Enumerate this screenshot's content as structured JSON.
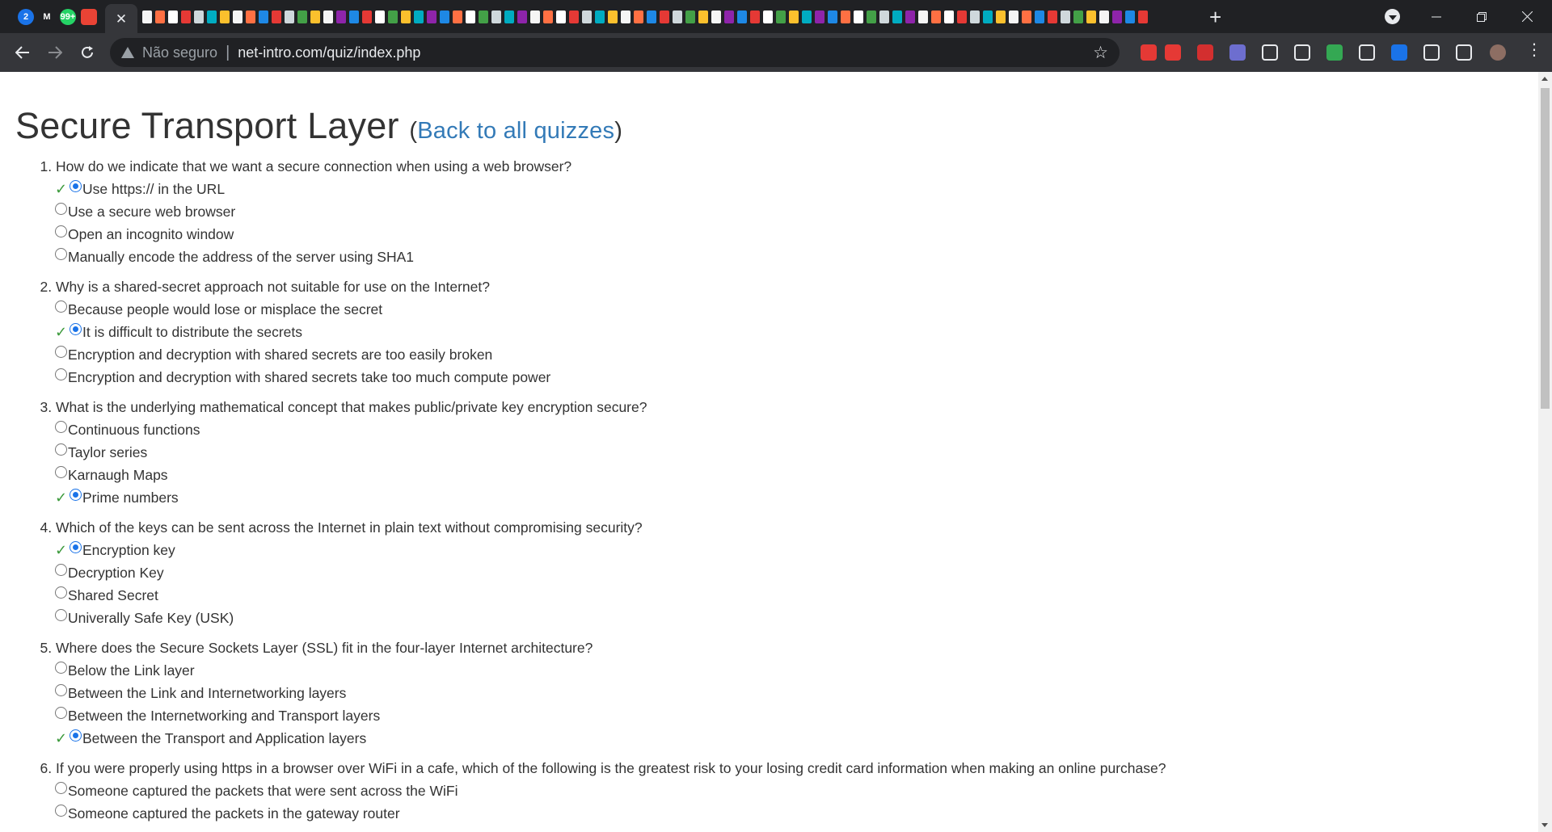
{
  "browser": {
    "pinned_tabs": [
      {
        "icon": "notification-badge-icon",
        "text": "2",
        "color": "#1a73e8"
      },
      {
        "icon": "gmail-icon",
        "text": "M",
        "color": "#202124"
      },
      {
        "icon": "whatsapp-icon",
        "text": "99+",
        "color": "#25d366"
      },
      {
        "icon": "maps-pin-icon",
        "text": "",
        "color": "#ea4335"
      }
    ],
    "active_tab_close": "✕",
    "new_tab": "+",
    "omnibox": {
      "security_status": "Não seguro",
      "separator": "|",
      "url": "net-intro.com/quiz/index.php"
    }
  },
  "page": {
    "title": "Secure Transport Layer",
    "back_open": "(",
    "back_link": "Back to all quizzes",
    "back_close": ")",
    "check_mark": "✓",
    "questions": [
      {
        "text": "How do we indicate that we want a secure connection when using a web browser?",
        "answers": [
          {
            "text": "Use https:// in the URL",
            "selected": true,
            "correct": true
          },
          {
            "text": "Use a secure web browser",
            "selected": false,
            "correct": false
          },
          {
            "text": "Open an incognito window",
            "selected": false,
            "correct": false
          },
          {
            "text": "Manually encode the address of the server using SHA1",
            "selected": false,
            "correct": false
          }
        ]
      },
      {
        "text": "Why is a shared-secret approach not suitable for use on the Internet?",
        "answers": [
          {
            "text": "Because people would lose or misplace the secret",
            "selected": false,
            "correct": false
          },
          {
            "text": "It is difficult to distribute the secrets",
            "selected": true,
            "correct": true
          },
          {
            "text": "Encryption and decryption with shared secrets are too easily broken",
            "selected": false,
            "correct": false
          },
          {
            "text": "Encryption and decryption with shared secrets take too much compute power",
            "selected": false,
            "correct": false
          }
        ]
      },
      {
        "text": "What is the underlying mathematical concept that makes public/private key encryption secure?",
        "answers": [
          {
            "text": "Continuous functions",
            "selected": false,
            "correct": false
          },
          {
            "text": "Taylor series",
            "selected": false,
            "correct": false
          },
          {
            "text": "Karnaugh Maps",
            "selected": false,
            "correct": false
          },
          {
            "text": "Prime numbers",
            "selected": true,
            "correct": true
          }
        ]
      },
      {
        "text": "Which of the keys can be sent across the Internet in plain text without compromising security?",
        "answers": [
          {
            "text": "Encryption key",
            "selected": true,
            "correct": true
          },
          {
            "text": "Decryption Key",
            "selected": false,
            "correct": false
          },
          {
            "text": "Shared Secret",
            "selected": false,
            "correct": false
          },
          {
            "text": "Univerally Safe Key (USK)",
            "selected": false,
            "correct": false
          }
        ]
      },
      {
        "text": "Where does the Secure Sockets Layer (SSL) fit in the four-layer Internet architecture?",
        "answers": [
          {
            "text": "Below the Link layer",
            "selected": false,
            "correct": false
          },
          {
            "text": "Between the Link and Internetworking layers",
            "selected": false,
            "correct": false
          },
          {
            "text": "Between the Internetworking and Transport layers",
            "selected": false,
            "correct": false
          },
          {
            "text": "Between the Transport and Application layers",
            "selected": true,
            "correct": true
          }
        ]
      },
      {
        "text": "If you were properly using https in a browser over WiFi in a cafe, which of the following is the greatest risk to your losing credit card information when making an online purchase?",
        "answers": [
          {
            "text": "Someone captured the packets that were sent across the WiFi",
            "selected": false,
            "correct": false
          },
          {
            "text": "Someone captured the packets in the gateway router",
            "selected": false,
            "correct": false
          }
        ]
      }
    ]
  },
  "colors": {
    "chrome_dark": "#202124",
    "toolbar": "#35363a",
    "link": "#337ab7",
    "check": "#3c9a3c",
    "radio_selected": "#1a73e8"
  }
}
